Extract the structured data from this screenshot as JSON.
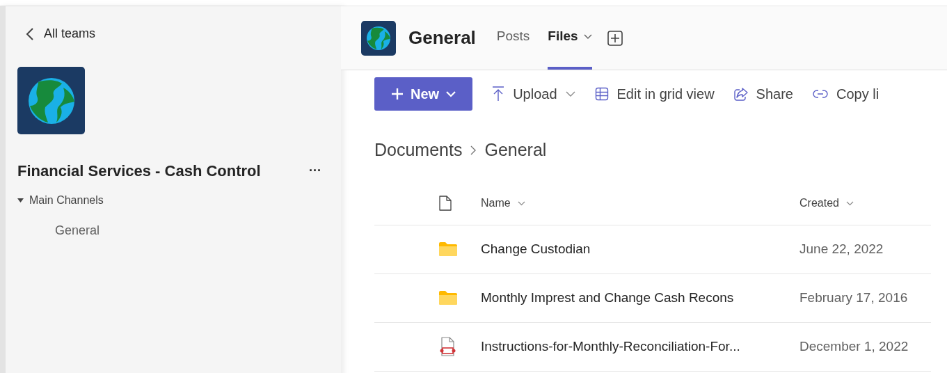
{
  "sidebar": {
    "back_link": "All teams",
    "team_name": "Financial Services - Cash Control",
    "more": "···",
    "sections": [
      {
        "label": "Main Channels",
        "expanded": true,
        "children": [
          {
            "label": "General",
            "selected": false
          }
        ]
      }
    ]
  },
  "header": {
    "channel": "General",
    "tabs": [
      {
        "label": "Posts",
        "selected": false,
        "has_menu": false
      },
      {
        "label": "Files",
        "selected": true,
        "has_menu": true
      }
    ]
  },
  "toolbar": [
    {
      "kind": "primary",
      "label": "New",
      "has_menu": true
    },
    {
      "kind": "plain",
      "label": "Upload",
      "has_menu": true
    },
    {
      "kind": "plain",
      "label": "Edit in grid view",
      "has_menu": false
    },
    {
      "kind": "plain",
      "label": "Share",
      "has_menu": false
    },
    {
      "kind": "plain",
      "label": "Copy li",
      "has_menu": false
    }
  ],
  "breadcrumb": [
    "Documents",
    "General"
  ],
  "table": {
    "columns": [
      "Name",
      "Created"
    ],
    "rows": [
      {
        "kind": "folder",
        "name": "Change Custodian",
        "created": "June 22, 2022"
      },
      {
        "kind": "folder",
        "name": "Monthly Imprest and Change Cash Recons",
        "created": "February 17, 2016"
      },
      {
        "kind": "pdf",
        "name": "Instructions-for-Monthly-Reconciliation-For...",
        "created": "December 1, 2022"
      }
    ]
  }
}
